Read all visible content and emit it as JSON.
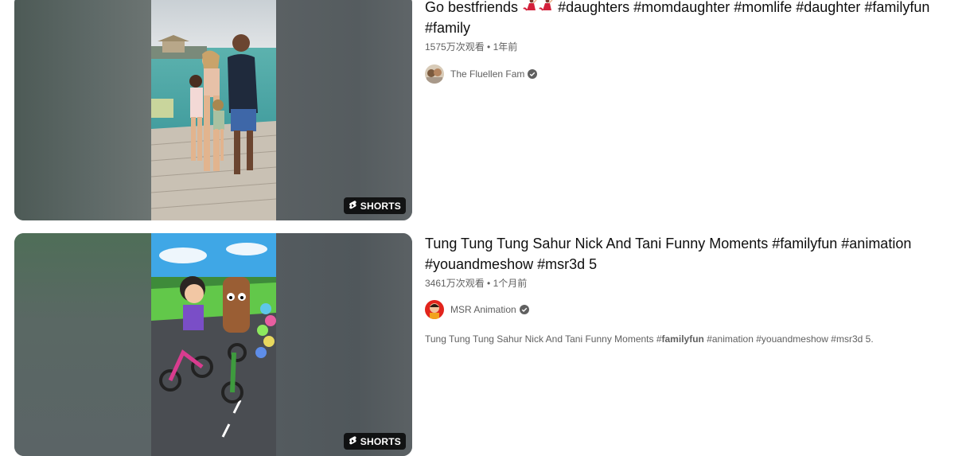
{
  "results": [
    {
      "title": "Go bestfriends",
      "title_emoji": [
        "dancer-emoji",
        "dancer-emoji"
      ],
      "title_tags": "#daughters #momdaughter #momlife #daughter #familyfun #family",
      "views": "1575万次观看",
      "separator": "•",
      "age": "1年前",
      "channel": "The Fluellen Fam",
      "badge": "SHORTS",
      "description_pre": "",
      "description_bold": "",
      "description_post": ""
    },
    {
      "title": "Tung Tung Tung Sahur Nick And Tani Funny Moments #familyfun #animation #youandmeshow #msr3d 5",
      "views": "3461万次观看",
      "separator": "•",
      "age": "1个月前",
      "channel": "MSR Animation",
      "badge": "SHORTS",
      "description_pre": "Tung Tung Tung Sahur Nick And Tani Funny Moments #",
      "description_bold": "familyfun",
      "description_post": " #animation #youandmeshow #msr3d 5."
    }
  ],
  "colors": {
    "text_primary": "#0f0f0f",
    "text_secondary": "#606060",
    "badge_bg": "#000000cc"
  }
}
